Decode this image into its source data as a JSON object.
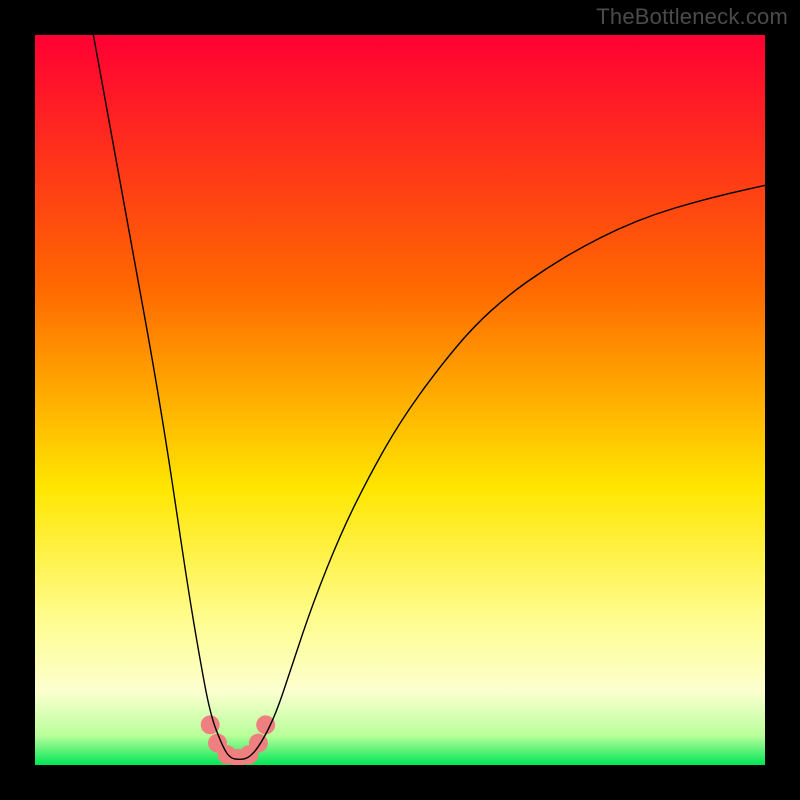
{
  "watermark": "TheBottleneck.com",
  "chart_data": {
    "type": "line",
    "title": "",
    "xlabel": "",
    "ylabel": "",
    "xlim": [
      0,
      100
    ],
    "ylim": [
      0,
      100
    ],
    "grid": false,
    "series": [
      {
        "name": "curve",
        "color": "#000000",
        "x": [
          8,
          10,
          12,
          14,
          16,
          18,
          19.5,
          21,
          22.5,
          24,
          25.5,
          26.6,
          28,
          29.4,
          31,
          33,
          35,
          38,
          42,
          46,
          50,
          55,
          60,
          65,
          70,
          75,
          80,
          85,
          90,
          95,
          100
        ],
        "y": [
          100,
          89,
          78,
          67,
          56,
          44,
          34,
          24,
          15,
          7,
          3,
          1,
          0.7,
          1,
          3,
          7,
          13,
          22,
          32,
          40,
          47,
          54,
          60,
          64.5,
          68,
          71,
          73.5,
          75.5,
          77,
          78.3,
          79.4
        ]
      }
    ],
    "markers": {
      "name": "bubbles",
      "color": "#F08080",
      "radius": 1.3,
      "x": [
        24.0,
        25.0,
        26.3,
        27.8,
        29.3,
        30.6,
        31.6
      ],
      "y": [
        5.5,
        3.0,
        1.4,
        0.9,
        1.4,
        3.0,
        5.5
      ]
    },
    "colors": {
      "gradient_top": "#ff0033",
      "gradient_mid1": "#ff6a00",
      "gradient_mid2": "#ffe600",
      "gradient_mid3": "#fbffcf",
      "gradient_bottom": "#00e756",
      "background": "#000000"
    }
  }
}
